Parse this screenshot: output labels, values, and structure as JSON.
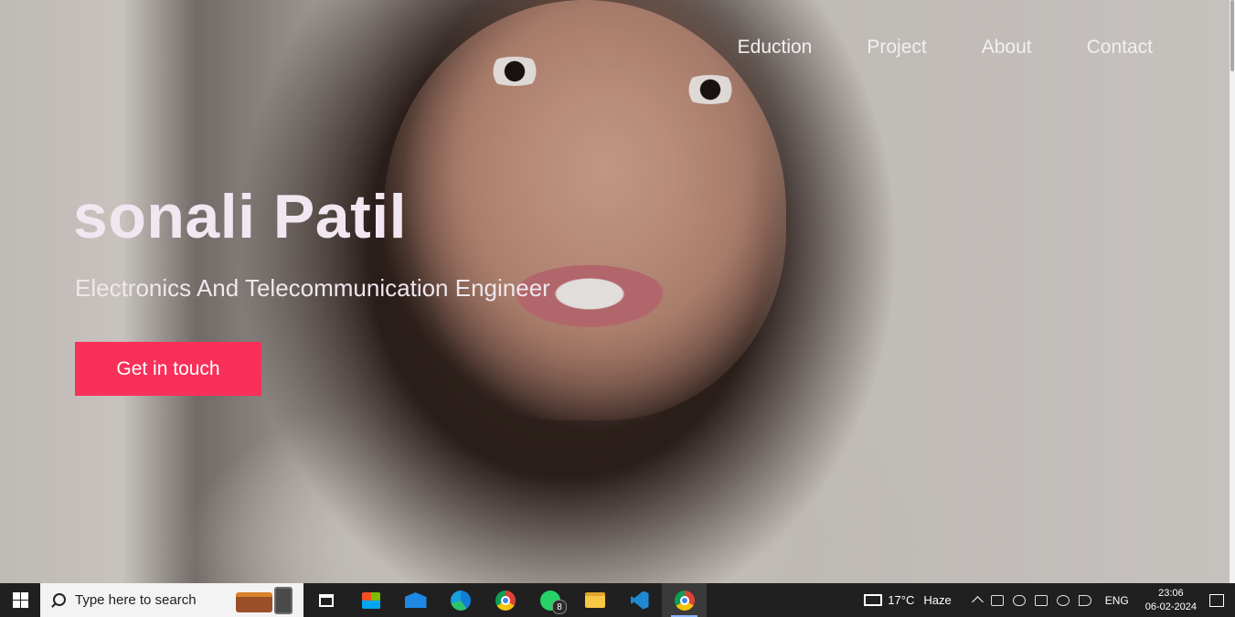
{
  "nav": {
    "items": [
      "Eduction",
      "Project",
      "About",
      "Contact"
    ]
  },
  "hero": {
    "name": "sonali Patil",
    "subtitle": "Electronics And Telecommunication Engineer",
    "cta_label": "Get in touch",
    "cta_color": "#f9305a"
  },
  "taskbar": {
    "search_placeholder": "Type here to search",
    "pinned_icons": [
      "task-view-icon",
      "microsoft-store-icon",
      "mail-icon",
      "edge-icon",
      "chrome-icon",
      "whatsapp-icon",
      "file-explorer-icon",
      "vscode-icon",
      "chrome-active-icon"
    ],
    "whatsapp_badge": "8",
    "weather_temp": "17°C",
    "weather_desc": "Haze",
    "language": "ENG",
    "time": "23:06",
    "date": "06-02-2024"
  }
}
